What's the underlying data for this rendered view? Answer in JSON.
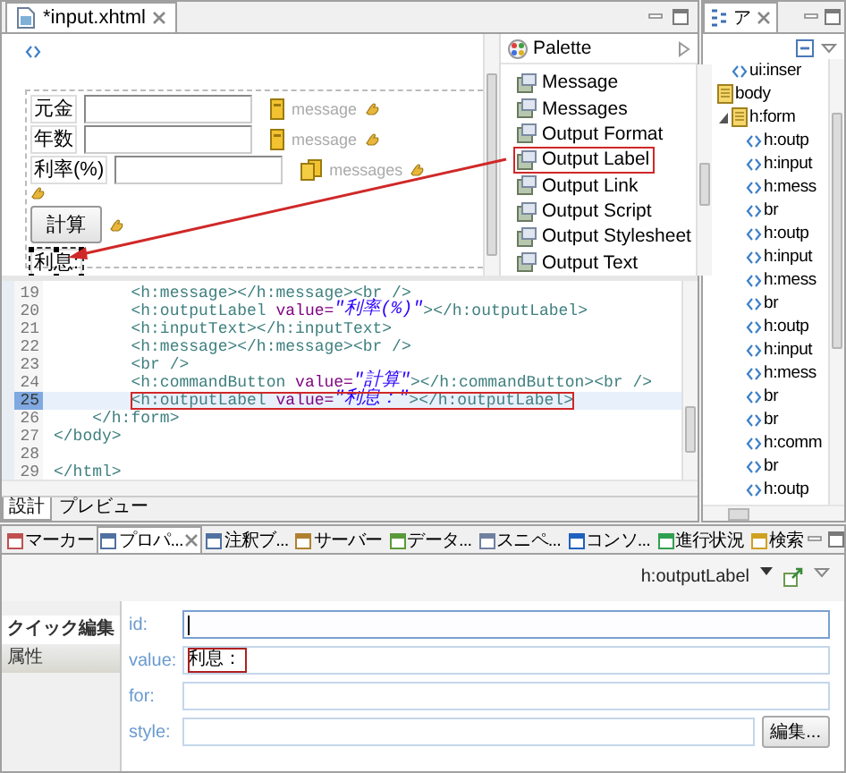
{
  "editor": {
    "tab": {
      "title": "*input.xhtml",
      "selected": true
    },
    "design": {
      "rows": [
        {
          "kind": "input",
          "label": "元金",
          "selected": false,
          "message": {
            "text": "message",
            "multiple": false
          }
        },
        {
          "kind": "input",
          "label": "年数",
          "selected": false,
          "message": {
            "text": "message",
            "multiple": false
          }
        },
        {
          "kind": "input",
          "label": "利率(%)",
          "selected": false,
          "message": {
            "text": "messages",
            "multiple": true
          }
        },
        {
          "kind": "break",
          "selected": false
        },
        {
          "kind": "button",
          "label": "計算",
          "selected": false
        },
        {
          "kind": "label",
          "label": "利息:",
          "selected": true
        }
      ]
    },
    "palette": {
      "title": "Palette",
      "items": [
        {
          "label": "Message",
          "highlighted": false
        },
        {
          "label": "Messages",
          "highlighted": false
        },
        {
          "label": "Output Format",
          "highlighted": false
        },
        {
          "label": "Output Label",
          "highlighted": true
        },
        {
          "label": "Output Link",
          "highlighted": false
        },
        {
          "label": "Output Script",
          "highlighted": false
        },
        {
          "label": "Output Stylesheet",
          "highlighted": false
        },
        {
          "label": "Output Text",
          "highlighted": false
        }
      ]
    },
    "source": {
      "lines": [
        {
          "number": "19",
          "text": "        <h:message></h:message><br />",
          "current": false,
          "highlighted": false
        },
        {
          "number": "20",
          "text": "        <h:outputLabel value=\"利率(%)\"></h:outputLabel>",
          "current": false,
          "highlighted": false
        },
        {
          "number": "21",
          "text": "        <h:inputText></h:inputText>",
          "current": false,
          "highlighted": false
        },
        {
          "number": "22",
          "text": "        <h:message></h:message><br />",
          "current": false,
          "highlighted": false
        },
        {
          "number": "23",
          "text": "        <br />",
          "current": false,
          "highlighted": false
        },
        {
          "number": "24",
          "text": "        <h:commandButton value=\"計算\"></h:commandButton><br />",
          "current": false,
          "highlighted": false
        },
        {
          "number": "25",
          "text": "        <h:outputLabel value=\"利息：\"></h:outputLabel>",
          "current": true,
          "highlighted": true
        },
        {
          "number": "26",
          "text": "    </h:form>",
          "current": false,
          "highlighted": false
        },
        {
          "number": "27",
          "text": "</body>",
          "current": false,
          "highlighted": false
        },
        {
          "number": "28",
          "current": false,
          "highlighted": false
        },
        {
          "number": "29",
          "text": "</html>",
          "current": false,
          "highlighted": false
        }
      ]
    },
    "view_tabs": [
      {
        "label": "設計",
        "selected": true
      },
      {
        "label": "プレビュー",
        "selected": false
      }
    ]
  },
  "outline": {
    "tab": {
      "title": "ア",
      "selected": true
    },
    "items": [
      {
        "children": [
          {
            "label": "ui:inser",
            "kind": "tag"
          }
        ]
      },
      {
        "label": "body",
        "kind": "node",
        "children": [
          {
            "label": "h:form",
            "kind": "node",
            "expanded": true,
            "children": [
              {
                "label": "h:outp",
                "kind": "tag"
              },
              {
                "label": "h:input",
                "kind": "tag"
              },
              {
                "label": "h:mess",
                "kind": "tag"
              },
              {
                "label": "br",
                "kind": "tag"
              },
              {
                "label": "h:outp",
                "kind": "tag"
              },
              {
                "label": "h:input",
                "kind": "tag"
              },
              {
                "label": "h:mess",
                "kind": "tag"
              },
              {
                "label": "br",
                "kind": "tag"
              },
              {
                "label": "h:outp",
                "kind": "tag"
              },
              {
                "label": "h:input",
                "kind": "tag"
              },
              {
                "label": "h:mess",
                "kind": "tag"
              },
              {
                "label": "br",
                "kind": "tag"
              },
              {
                "label": "br",
                "kind": "tag"
              },
              {
                "label": "h:comm",
                "kind": "tag"
              },
              {
                "label": "br",
                "kind": "tag"
              },
              {
                "label": "h:outp",
                "kind": "tag"
              }
            ]
          }
        ]
      }
    ]
  },
  "properties": {
    "tabs": [
      {
        "label": "マーカー",
        "selected": false
      },
      {
        "label": "プロパ...",
        "selected": true
      },
      {
        "label": "注釈ブ...",
        "selected": false
      },
      {
        "label": "サーバー",
        "selected": false
      },
      {
        "label": "データ...",
        "selected": false
      },
      {
        "label": "スニペ...",
        "selected": false
      },
      {
        "label": "コンソ...",
        "selected": false
      },
      {
        "label": "進行状況",
        "selected": false
      },
      {
        "label": "検索",
        "selected": false
      }
    ],
    "element": "h:outputLabel",
    "side_tabs": [
      {
        "label": "クイック編集",
        "selected": true
      },
      {
        "label": "属性",
        "selected": false
      }
    ],
    "fields": [
      {
        "label": "id:",
        "focused": true,
        "highlighted": false
      },
      {
        "label": "value:",
        "value": "利息：",
        "focused": false,
        "highlighted": true
      },
      {
        "label": "for:",
        "focused": false,
        "highlighted": false
      },
      {
        "label": "style:",
        "focused": false,
        "highlighted": false,
        "button": "編集..."
      }
    ]
  },
  "arrow_to_selection": true
}
